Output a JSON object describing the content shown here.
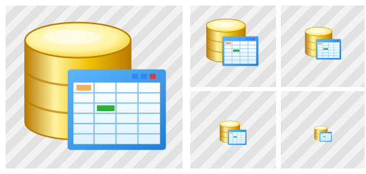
{
  "icon": {
    "name": "database-table-view-icon",
    "colors": {
      "cylinder_light": "#fff3a0",
      "cylinder_mid": "#f2c200",
      "cylinder_dark": "#b97a00",
      "window_frame": "#1e7fd8",
      "window_bg": "#dff2ff",
      "grid_line": "#7fc2ef",
      "header_dot_blue": "#2f86ff",
      "header_dot_red": "#e23b2f",
      "cell_orange": "#f0a23a",
      "cell_green": "#2fae3c"
    },
    "variants": [
      "large",
      "medium",
      "small",
      "smaller",
      "tiny"
    ]
  },
  "background": {
    "tile_color": "#e2e2e2",
    "stripe_color": "#ffffff"
  }
}
